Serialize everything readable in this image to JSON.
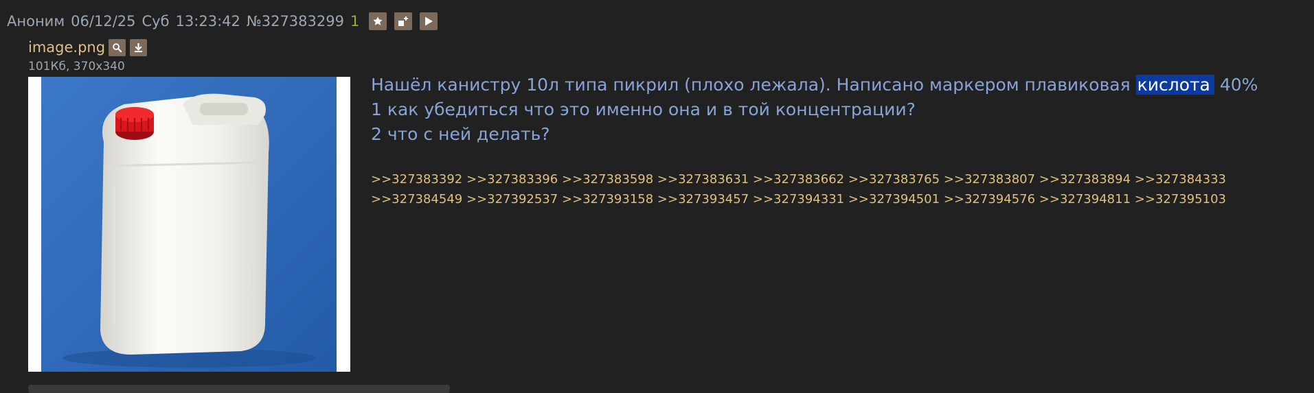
{
  "post": {
    "author": "Аноним",
    "date": "06/12/25",
    "weekday": "Суб",
    "time": "13:23:42",
    "number": "№327383299",
    "reply_count": "1",
    "header_icons": [
      "star-icon",
      "add-window-icon",
      "play-icon"
    ]
  },
  "file": {
    "name": "image.png",
    "size": "101Кб",
    "dimensions": "370x340",
    "meta": "101Кб, 370x340",
    "icons": [
      "search-icon",
      "download-icon"
    ]
  },
  "message": {
    "line1_before": "Нашёл канистру 10л типа пикрил (плохо лежала). Написано маркером плавиковая ",
    "line1_highlight": "кислота",
    "line1_after": " 40%",
    "line2": "1 как убедиться что это именно она и в той концентрации?",
    "line3": "2 что с ней делать?"
  },
  "replies": [
    ">>327383392",
    ">>327383396",
    ">>327383598",
    ">>327383631",
    ">>327383662",
    ">>327383765",
    ">>327383807",
    ">>327383894",
    ">>327384333",
    ">>327384549",
    ">>327392537",
    ">>327393158",
    ">>327393457",
    ">>327394331",
    ">>327394501",
    ">>327394576",
    ">>327394811",
    ">>327395103"
  ],
  "colors": {
    "background": "#212121",
    "header_text": "#9aa7b4",
    "reply_count": "#8fb040",
    "file_name": "#e0c080",
    "message_text": "#86a4d8",
    "highlight_bg": "#0b3aa0",
    "reply_links": "#e0c080",
    "icon_button": "#7d6a5b"
  }
}
